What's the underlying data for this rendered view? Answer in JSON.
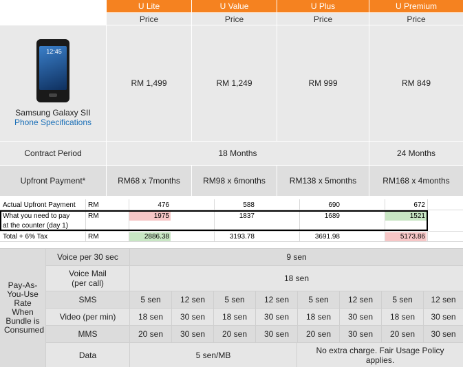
{
  "plans": [
    {
      "name": "U Lite",
      "price_label": "Price",
      "price": "RM 1,499",
      "upfront": "RM68 x 7months"
    },
    {
      "name": "U Value",
      "price_label": "Price",
      "price": "RM 1,249",
      "upfront": "RM98 x 6months"
    },
    {
      "name": "U Plus",
      "price_label": "Price",
      "price": "RM 999",
      "upfront": "RM138 x 5months"
    },
    {
      "name": "U Premium",
      "price_label": "Price",
      "price": "RM 849",
      "upfront": "RM168 x 4months"
    }
  ],
  "phone": {
    "name": "Samsung Galaxy SII",
    "spec_link": "Phone Specifications",
    "screen_time": "12:45"
  },
  "contract": {
    "label": "Contract Period",
    "months_18": "18 Months",
    "months_24": "24 Months"
  },
  "upfront": {
    "label": "Upfront Payment*"
  },
  "sheet": {
    "rows": [
      {
        "label": "Actual Upfront Payment",
        "unit": "RM",
        "values": [
          "476",
          "588",
          "690",
          "672"
        ]
      },
      {
        "label": "What you need to pay",
        "label2": "at the counter (day 1)",
        "unit": "RM",
        "values": [
          "1975",
          "1837",
          "1689",
          "1521"
        ]
      },
      {
        "label": "Total + 6% Tax",
        "unit": "RM",
        "values": [
          "2886.38",
          "3193.78",
          "3691.98",
          "5173.86"
        ]
      }
    ],
    "colors": {
      "red": "#f6c6c6",
      "green": "#c8e6c4"
    }
  },
  "payg": {
    "side_label": "Pay-As-You-Use Rate When Bundle is Consumed",
    "voice_label": "Voice per 30 sec",
    "voice_value": "9 sen",
    "voicemail_label": "Voice Mail (per call)",
    "voicemail_value": "18 sen",
    "sms_label": "SMS",
    "sms_values": [
      "5 sen",
      "12 sen",
      "5 sen",
      "12 sen",
      "5 sen",
      "12 sen",
      "5 sen",
      "12 sen"
    ],
    "video_label": "Video (per min)",
    "video_values": [
      "18 sen",
      "30 sen",
      "18 sen",
      "30 sen",
      "18 sen",
      "30 sen",
      "18 sen",
      "30 sen"
    ],
    "mms_label": "MMS",
    "mms_values": [
      "20 sen",
      "30 sen",
      "20 sen",
      "30 sen",
      "20 sen",
      "30 sen",
      "20 sen",
      "30 sen"
    ],
    "data_label": "Data",
    "data_value": "5 sen/MB",
    "data_value_premium": "No extra charge. Fair Usage Policy applies."
  },
  "accent": "#f58220"
}
